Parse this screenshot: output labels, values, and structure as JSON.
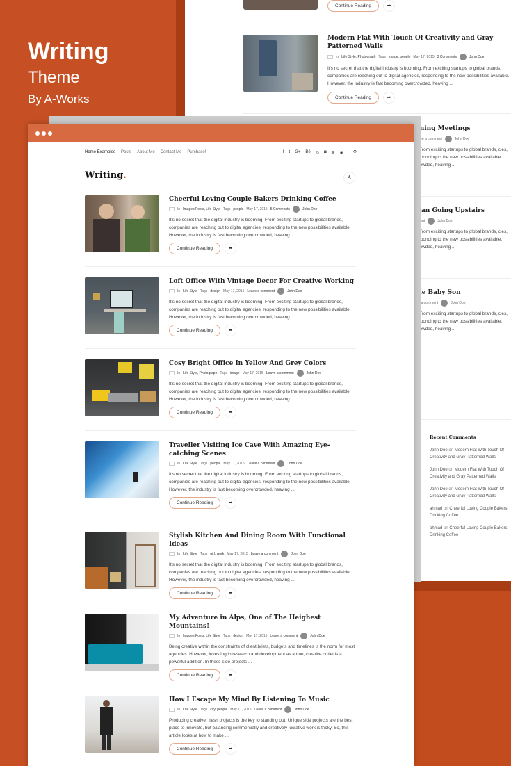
{
  "hero": {
    "title": "Writing",
    "subtitle": "Theme",
    "by": "By A-Works"
  },
  "bg_posts": [
    {
      "title": "Modern Flat With Touch Of Creativity and Gray Patterned Walls",
      "meta_in": "In",
      "meta_cats": "Life Style, Photograph",
      "meta_tags_label": "Tags",
      "meta_tags": "image, people",
      "meta_date": "May 17, 2015",
      "meta_comments": "3 Comments",
      "meta_author": "John Doe",
      "excerpt": "It's no secret that the digital industry is booming. From exciting startups to global brands, companies are reaching out to digital agencies, responding to the new possibilities available. However, the industry is fast becoming overcrowded, heaving ...",
      "button": "Continue Reading"
    }
  ],
  "bg_partial": [
    {
      "title": "rming Meetings",
      "meta": "Leave a comment",
      "author": "John Doe",
      "excerpt": "n. From exciting startups to global brands, cies, responding to the new possibilities available. rcrowded, heaving ..."
    },
    {
      "title": "Man Going Upstairs",
      "meta": "mment",
      "author": "John Doe",
      "excerpt": "n. From exciting startups to global brands, cies, responding to the new possibilities available. rcrowded, heaving ..."
    },
    {
      "title": "ute Baby Son",
      "meta": "ave a comment",
      "author": "John Doe",
      "excerpt": "n. From exciting startups to global brands, cies, responding to the new possibilities available. rcrowded, heaving ..."
    }
  ],
  "top_partial_button": "Continue Reading",
  "recent_comments": {
    "title": "Recent Comments",
    "items": [
      {
        "author": "John Doe",
        "on": "on",
        "post": "Modern Flat With Touch Of Creativity and Gray Patterned Walls"
      },
      {
        "author": "John Doe",
        "on": "on",
        "post": "Modern Flat With Touch Of Creativity and Gray Patterned Walls"
      },
      {
        "author": "John Doe",
        "on": "on",
        "post": "Modern Flat With Touch Of Creativity and Gray Patterned Walls"
      },
      {
        "author": "ahmad",
        "on": "on",
        "post": "Cheerful Loving Couple Bakers Drinking Coffee"
      },
      {
        "author": "ahmad",
        "on": "on",
        "post": "Cheerful Loving Couple Bakers Drinking Coffee"
      }
    ]
  },
  "nav": {
    "items": [
      "Home Examples",
      "Posts",
      "About Me",
      "Contact Me",
      "Purchase!"
    ],
    "social": [
      "f",
      "t",
      "G+",
      "Bē",
      "◎",
      "◙",
      "⊗",
      "◉",
      "⊙"
    ]
  },
  "logo": "Writing",
  "logo_dot": ".",
  "posts": [
    {
      "title": "Cheerful Loving Couple Bakers Drinking Coffee",
      "in": "In",
      "cats": "Images Posts, Life Style",
      "tags_label": "Tags",
      "tags": "people",
      "date": "May 17, 2015",
      "comments": "5 Comments",
      "author": "John Doe",
      "excerpt": "It's no secret that the digital industry is booming. From exciting startups to global brands, companies are reaching out to digital agencies, responding to the new possibilities available. However, the industry is fast becoming overcrowded, heaving ...",
      "button": "Continue Reading",
      "thumb_bg": "#7a6a5a"
    },
    {
      "title": "Loft Office With Vintage Decor For Creative Working",
      "in": "In",
      "cats": "Life Style",
      "tags_label": "Tags",
      "tags": "design",
      "date": "May 17, 2015",
      "comments": "Leave a comment",
      "author": "John Doe",
      "excerpt": "It's no secret that the digital industry is booming. From exciting startups to global brands, companies are reaching out to digital agencies, responding to the new possibilities available. However, the industry is fast becoming overcrowded, heaving ...",
      "button": "Continue Reading",
      "thumb_bg": "#4a5258"
    },
    {
      "title": "Cosy Bright Office In Yellow And Grey Colors",
      "in": "In",
      "cats": "Life Style, Photograph",
      "tags_label": "Tags",
      "tags": "image",
      "date": "May 17, 2015",
      "comments": "Leave a comment",
      "author": "John Doe",
      "excerpt": "It's no secret that the digital industry is booming. From exciting startups to global brands, companies are reaching out to digital agencies, responding to the new possibilities available. However, the industry is fast becoming overcrowded, heaving ...",
      "button": "Continue Reading",
      "thumb_bg": "#3a3a3a"
    },
    {
      "title": "Traveller Visiting Ice Cave With Amazing Eye-catching Scenes",
      "in": "In",
      "cats": "Life Style",
      "tags_label": "Tags",
      "tags": "people",
      "date": "May 17, 2015",
      "comments": "Leave a comment",
      "author": "John Doe",
      "excerpt": "It's no secret that the digital industry is booming. From exciting startups to global brands, companies are reaching out to digital agencies, responding to the new possibilities available. However, the industry is fast becoming overcrowded, heaving ...",
      "button": "Continue Reading",
      "thumb_bg": "#3d7fb8"
    },
    {
      "title": "Stylish Kitchen And Dining Room With Functional Ideas",
      "in": "In",
      "cats": "Life Style",
      "tags_label": "Tags",
      "tags": "girl, work",
      "date": "May 17, 2015",
      "comments": "Leave a comment",
      "author": "John Doe",
      "excerpt": "It's no secret that the digital industry is booming. From exciting startups to global brands, companies are reaching out to digital agencies, responding to the new possibilities available. However, the industry is fast becoming overcrowded, heaving ...",
      "button": "Continue Reading",
      "thumb_bg": "#3b3d3c"
    },
    {
      "title": "My Adventure in Alps, One of The Heighest Mountains!",
      "in": "In",
      "cats": "Images Posts, Life Style",
      "tags_label": "Tags",
      "tags": "design",
      "date": "May 17, 2015",
      "comments": "Leave a comment",
      "author": "John Doe",
      "excerpt": "Being creative within the constraints of client briefs, budgets and timelines is the norm for most agencies. However, investing in research and development as a true, creative outlet is a powerful addition. In these side projects ...",
      "button": "Continue Reading",
      "thumb_bg": "#1b1b1b"
    },
    {
      "title": "How I Escape My Mind By Listening To Music",
      "in": "In",
      "cats": "Life Style",
      "tags_label": "Tags",
      "tags": "city, people",
      "date": "May 17, 2015",
      "comments": "Leave a comment",
      "author": "John Doe",
      "excerpt": "Producing creative, fresh projects is the key to standing out. Unique side projects are the best place to innovate, but balancing commercially and creatively lucrative work is tricky. So, this article looks at how to make ...",
      "button": "Continue Reading",
      "thumb_bg": "#d8d4cf"
    }
  ],
  "colors": {
    "brand": "#c65023",
    "brand_dark": "#a83c13",
    "browser_bar": "#d76a40"
  }
}
